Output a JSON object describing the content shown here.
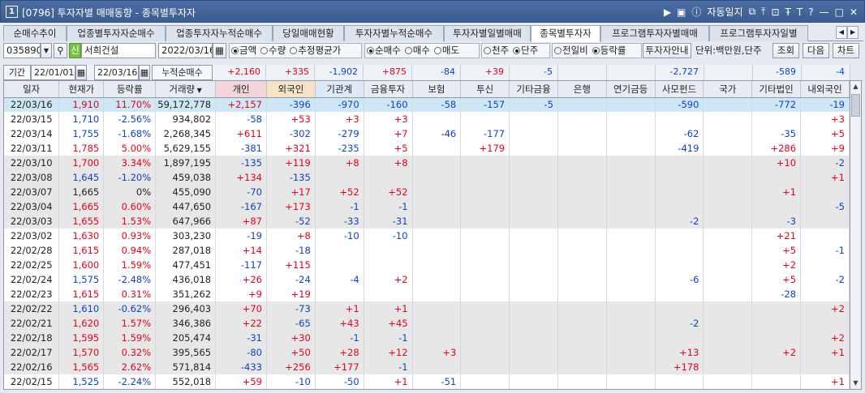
{
  "window": {
    "number": "1",
    "title": "[0796] 투자자별 매매동향 - 종목별투자자",
    "journal": "자동일지"
  },
  "tabs": [
    "순매수추이",
    "업종별투자자순매수",
    "업종투자자누적순매수",
    "당일매매현황",
    "투자자별누적순매수",
    "투자자별일별매매",
    "종목별투자자",
    "프로그램투자자별매매",
    "프로그램투자자일별"
  ],
  "active_tab": "종목별투자자",
  "toolbar": {
    "code": "035890",
    "stock_name": "서희건설",
    "date": "2022/03/16",
    "amount_opts": [
      "금액",
      "수량",
      "추정평균가"
    ],
    "amount_selected": "금액",
    "trade_opts": [
      "순매수",
      "매수",
      "매도"
    ],
    "trade_selected": "순매수",
    "unit_opts": [
      "천주",
      "단주"
    ],
    "unit_selected": "단주",
    "compare_opts": [
      "전일비",
      "등락률"
    ],
    "compare_selected": "등락률",
    "guide_btn": "투자자안내",
    "unit_label": "단위:백만원,단주",
    "query_btn": "조회",
    "next_btn": "다음",
    "chart_btn": "차트"
  },
  "period": {
    "label": "기간",
    "from": "22/01/01",
    "to": "22/03/16",
    "cum_label": "누적순매수"
  },
  "cumulative": [
    "+2,160",
    "+335",
    "-1,902",
    "+875",
    "-84",
    "+39",
    "-5",
    "",
    "",
    "-2,727",
    "",
    "-589",
    "-4"
  ],
  "columns": [
    "일자",
    "현재가",
    "등락률",
    "거래량",
    "개인",
    "외국인",
    "기관계",
    "금융투자",
    "보험",
    "투신",
    "기타금융",
    "은행",
    "연기금등",
    "사모펀드",
    "국가",
    "기타법인",
    "내외국인"
  ],
  "rows": [
    [
      "22/03/16",
      "1,910",
      "11.70%",
      "59,172,778",
      "+2,157",
      "-396",
      "-970",
      "-160",
      "-58",
      "-157",
      "-5",
      "",
      "",
      "-590",
      "",
      "-772",
      "-19"
    ],
    [
      "22/03/15",
      "1,710",
      "-2.56%",
      "934,802",
      "-58",
      "+53",
      "+3",
      "+3",
      "",
      "",
      "",
      "",
      "",
      "",
      "",
      "",
      "+3"
    ],
    [
      "22/03/14",
      "1,755",
      "-1.68%",
      "2,268,345",
      "+611",
      "-302",
      "-279",
      "+7",
      "-46",
      "-177",
      "",
      "",
      "",
      "-62",
      "",
      "-35",
      "+5"
    ],
    [
      "22/03/11",
      "1,785",
      "5.00%",
      "5,629,155",
      "-381",
      "+321",
      "-235",
      "+5",
      "",
      "+179",
      "",
      "",
      "",
      "-419",
      "",
      "+286",
      "+9"
    ],
    [
      "22/03/10",
      "1,700",
      "3.34%",
      "1,897,195",
      "-135",
      "+119",
      "+8",
      "+8",
      "",
      "",
      "",
      "",
      "",
      "",
      "",
      "+10",
      "-2"
    ],
    [
      "22/03/08",
      "1,645",
      "-1.20%",
      "459,038",
      "+134",
      "-135",
      "",
      "",
      "",
      "",
      "",
      "",
      "",
      "",
      "",
      "",
      "+1"
    ],
    [
      "22/03/07",
      "1,665",
      "0%",
      "455,090",
      "-70",
      "+17",
      "+52",
      "+52",
      "",
      "",
      "",
      "",
      "",
      "",
      "",
      "+1",
      ""
    ],
    [
      "22/03/04",
      "1,665",
      "0.60%",
      "447,650",
      "-167",
      "+173",
      "-1",
      "-1",
      "",
      "",
      "",
      "",
      "",
      "",
      "",
      "",
      "-5"
    ],
    [
      "22/03/03",
      "1,655",
      "1.53%",
      "647,966",
      "+87",
      "-52",
      "-33",
      "-31",
      "",
      "",
      "",
      "",
      "",
      "-2",
      "",
      "-3",
      ""
    ],
    [
      "22/03/02",
      "1,630",
      "0.93%",
      "303,230",
      "-19",
      "+8",
      "-10",
      "-10",
      "",
      "",
      "",
      "",
      "",
      "",
      "",
      "+21",
      ""
    ],
    [
      "22/02/28",
      "1,615",
      "0.94%",
      "287,018",
      "+14",
      "-18",
      "",
      "",
      "",
      "",
      "",
      "",
      "",
      "",
      "",
      "+5",
      "-1"
    ],
    [
      "22/02/25",
      "1,600",
      "1.59%",
      "477,451",
      "-117",
      "+115",
      "",
      "",
      "",
      "",
      "",
      "",
      "",
      "",
      "",
      "+2",
      ""
    ],
    [
      "22/02/24",
      "1,575",
      "-2.48%",
      "436,018",
      "+26",
      "-24",
      "-4",
      "+2",
      "",
      "",
      "",
      "",
      "",
      "-6",
      "",
      "+5",
      "-2"
    ],
    [
      "22/02/23",
      "1,615",
      "0.31%",
      "351,262",
      "+9",
      "+19",
      "",
      "",
      "",
      "",
      "",
      "",
      "",
      "",
      "",
      "-28",
      ""
    ],
    [
      "22/02/22",
      "1,610",
      "-0.62%",
      "296,403",
      "+70",
      "-73",
      "+1",
      "+1",
      "",
      "",
      "",
      "",
      "",
      "",
      "",
      "",
      "+2"
    ],
    [
      "22/02/21",
      "1,620",
      "1.57%",
      "346,386",
      "+22",
      "-65",
      "+43",
      "+45",
      "",
      "",
      "",
      "",
      "",
      "-2",
      "",
      "",
      ""
    ],
    [
      "22/02/18",
      "1,595",
      "1.59%",
      "205,474",
      "-31",
      "+30",
      "-1",
      "-1",
      "",
      "",
      "",
      "",
      "",
      "",
      "",
      "",
      "+2"
    ],
    [
      "22/02/17",
      "1,570",
      "0.32%",
      "395,565",
      "-80",
      "+50",
      "+28",
      "+12",
      "+3",
      "",
      "",
      "",
      "",
      "+13",
      "",
      "+2",
      "+1"
    ],
    [
      "22/02/16",
      "1,565",
      "2.62%",
      "571,814",
      "-433",
      "+256",
      "+177",
      "-1",
      "",
      "",
      "",
      "",
      "",
      "+178",
      "",
      "",
      ""
    ],
    [
      "22/02/15",
      "1,525",
      "-2.24%",
      "552,018",
      "+59",
      "-10",
      "-50",
      "+1",
      "-51",
      "",
      "",
      "",
      "",
      "",
      "",
      "",
      "+1"
    ]
  ],
  "colors": {
    "up": "#e4001e",
    "down": "#1040c8",
    "selected_row": "#cfe6f5"
  }
}
